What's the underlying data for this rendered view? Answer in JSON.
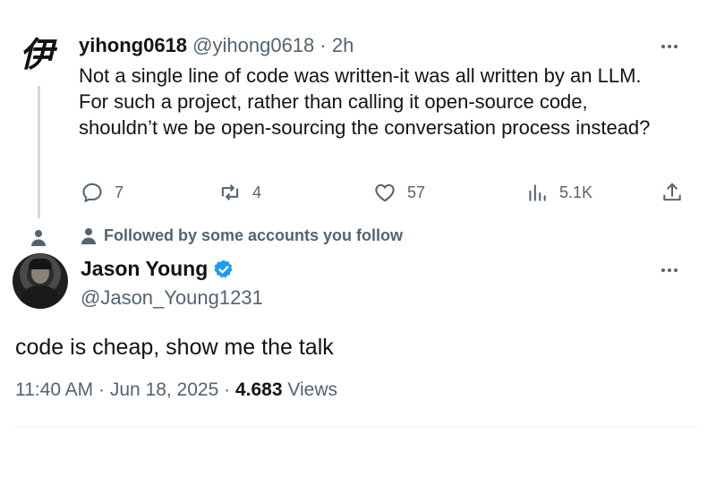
{
  "parent_tweet": {
    "avatar_glyph": "伊",
    "display_name": "yihong0618",
    "handle": "@yihong0618",
    "separator": "·",
    "time_ago": "2h",
    "text": "Not a single line of code was written-it was all written by an LLM. For such a project, rather than calling it open-source code, shouldn’t we be open-sourcing the conversation process instead?",
    "actions": {
      "replies": "7",
      "reposts": "4",
      "likes": "57",
      "views": "5.1K"
    },
    "more_icon": "more-horizontal-icon"
  },
  "followed_notice": {
    "icon": "person-icon",
    "text": "Followed by some accounts you follow"
  },
  "reply_tweet": {
    "display_name": "Jason Young",
    "verified_icon": "verified-badge-icon",
    "verified_color": "#1d9bf0",
    "handle": "@Jason_Young1231",
    "text": "code is cheap, show me the talk",
    "timestamp": "11:40 AM · Jun 18, 2025 ·",
    "views_count": "4.683",
    "views_label": "Views"
  },
  "colors": {
    "text_primary": "#0f1419",
    "text_secondary": "#536471",
    "thread_line": "#cfd9de"
  }
}
